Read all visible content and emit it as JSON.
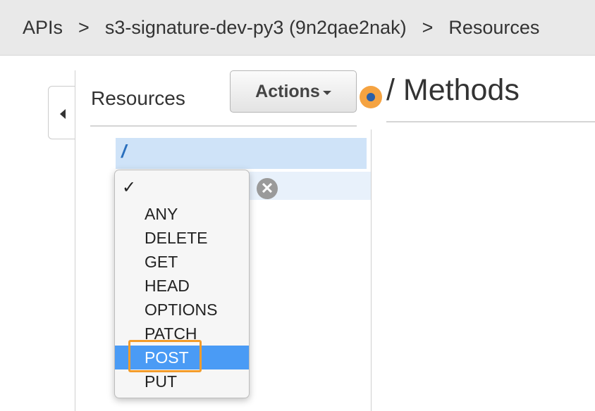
{
  "breadcrumb": {
    "apis": "APIs",
    "sep1": ">",
    "api_name": "s3-signature-dev-py3 (9n2qae2nak)",
    "sep2": ">",
    "current": "Resources"
  },
  "resources_panel": {
    "title": "Resources",
    "actions_label": "Actions",
    "root_path": "/"
  },
  "methods_panel": {
    "title": "/ Methods"
  },
  "method_dropdown": {
    "check": "✓",
    "options": [
      "ANY",
      "DELETE",
      "GET",
      "HEAD",
      "OPTIONS",
      "PATCH",
      "POST",
      "PUT"
    ],
    "selected": "POST"
  },
  "icons": {
    "collapse": "caret-left-icon",
    "cancel": "close-circle-icon",
    "cancel_glyph": "✕",
    "marker": "orange-dot-marker"
  },
  "colors": {
    "selected_option": "#4a9bf5",
    "highlight": "#f39c2b",
    "root_selected_bg": "#cfe3f8"
  }
}
